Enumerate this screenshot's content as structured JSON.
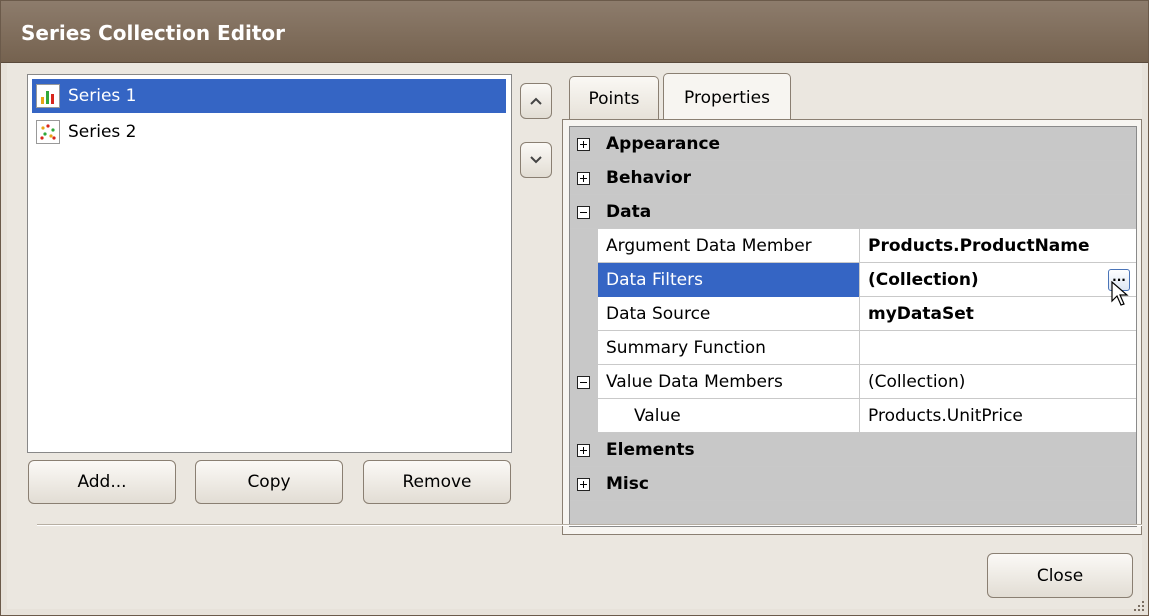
{
  "window": {
    "title": "Series Collection Editor"
  },
  "series_list": {
    "items": [
      {
        "label": "Series 1",
        "icon": "bar-chart-icon",
        "selected": true
      },
      {
        "label": "Series 2",
        "icon": "point-chart-icon",
        "selected": false
      }
    ]
  },
  "buttons": {
    "add": "Add...",
    "copy": "Copy",
    "remove": "Remove",
    "close": "Close"
  },
  "tabs": [
    {
      "label": "Points",
      "active": false
    },
    {
      "label": "Properties",
      "active": true
    }
  ],
  "properties": {
    "appearance": "Appearance",
    "behavior": "Behavior",
    "data": "Data",
    "argument_data_member": {
      "name": "Argument Data Member",
      "value": "Products.ProductName"
    },
    "data_filters": {
      "name": "Data Filters",
      "value": "(Collection)",
      "button": "..."
    },
    "data_source": {
      "name": "Data Source",
      "value": "myDataSet"
    },
    "summary_function": {
      "name": "Summary Function",
      "value": ""
    },
    "value_data_members": {
      "name": "Value Data Members",
      "value": "(Collection)"
    },
    "value": {
      "name": "Value",
      "value": "Products.UnitPrice"
    },
    "elements": "Elements",
    "misc": "Misc"
  },
  "colors": {
    "selection": "#3565c4",
    "titlebar": "#7e6b58",
    "category_row": "#c8c8c8"
  }
}
